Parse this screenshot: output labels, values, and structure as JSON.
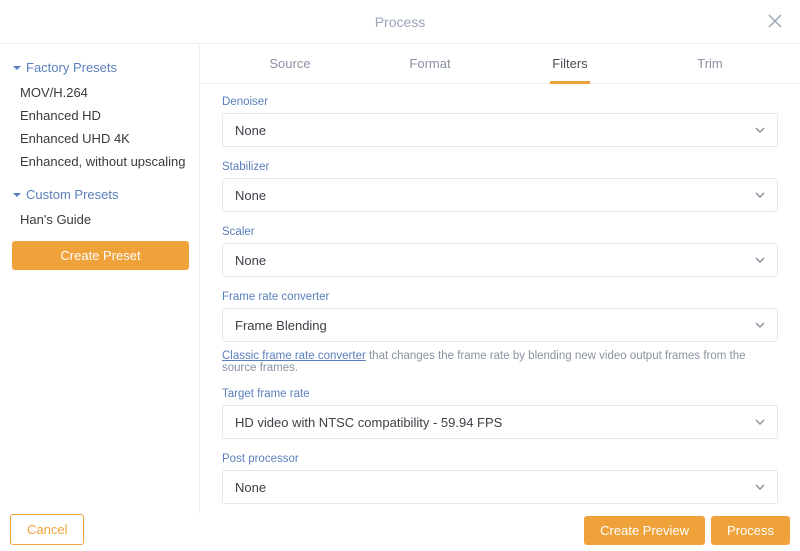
{
  "header": {
    "title": "Process"
  },
  "sidebar": {
    "factory": {
      "title": "Factory Presets",
      "items": [
        "MOV/H.264",
        "Enhanced HD",
        "Enhanced UHD 4K",
        "Enhanced, without upscaling"
      ]
    },
    "custom": {
      "title": "Custom Presets",
      "items": [
        "Han's Guide"
      ]
    },
    "create_label": "Create Preset"
  },
  "tabs": {
    "source": "Source",
    "format": "Format",
    "filters": "Filters",
    "trim": "Trim"
  },
  "filters": {
    "denoiser": {
      "label": "Denoiser",
      "value": "None"
    },
    "stabilizer": {
      "label": "Stabilizer",
      "value": "None"
    },
    "scaler": {
      "label": "Scaler",
      "value": "None"
    },
    "frame_rate_converter": {
      "label": "Frame rate converter",
      "value": "Frame Blending",
      "help_link": "Classic frame rate converter",
      "help_text": " that changes the frame rate by blending new video output frames from the source frames."
    },
    "target_frame_rate": {
      "label": "Target frame rate",
      "value": "HD video with NTSC compatibility - 59.94 FPS"
    },
    "post_processor": {
      "label": "Post processor",
      "value": "None"
    }
  },
  "footer": {
    "cancel": "Cancel",
    "create_preview": "Create Preview",
    "process": "Process"
  }
}
